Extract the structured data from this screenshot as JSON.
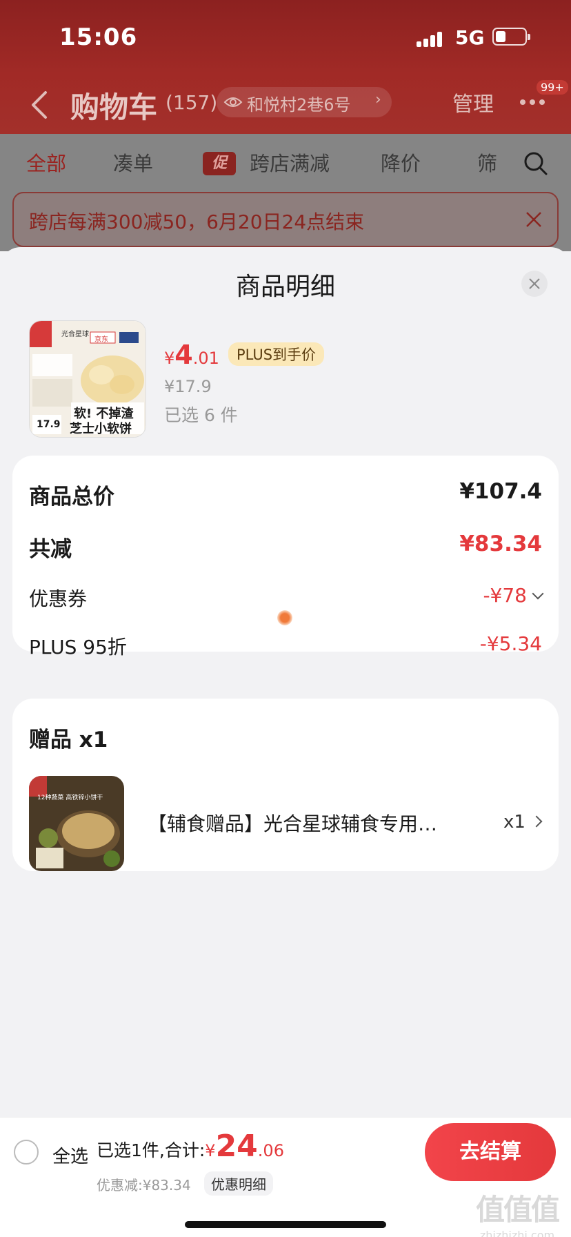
{
  "status_bar": {
    "time": "15:06",
    "network": "5G"
  },
  "nav": {
    "title": "购物车",
    "count": "(157)",
    "address": "和悦村2巷6号",
    "manage": "管理",
    "badge": "99+"
  },
  "tabs": [
    {
      "label": "全部"
    },
    {
      "label": "凑单"
    },
    {
      "label": "跨店满减",
      "tag": "促"
    },
    {
      "label": "降价"
    },
    {
      "label": "筛"
    }
  ],
  "notice": {
    "text": "跨店每满300减50，6月20日24点结束"
  },
  "sheet": {
    "title": "商品明细",
    "product": {
      "price_currency": "¥",
      "price_int": "4",
      "price_dec": ".01",
      "plus_tag": "PLUS到手价",
      "original_price": "¥17.9",
      "selected": "已选 6 件",
      "image_text": {
        "brand": "光合星球",
        "tag1": "软! 不掉渣",
        "tag2": "芝士小软饼",
        "price": "17.9",
        "jd": "京东"
      }
    },
    "summary": {
      "total_label": "商品总价",
      "total_value": "¥107.4",
      "reduce_label": "共减",
      "reduce_value": "¥83.34",
      "coupon_label": "优惠券",
      "coupon_value": "-¥78",
      "plus_label": "PLUS 95折",
      "plus_value": "-¥5.34"
    },
    "gift": {
      "title": "赠品 x1",
      "name": "【辅食赠品】光合星球辅食专用…",
      "qty": "x1",
      "image_text": "12种蔬菜 高铁锌小饼干"
    }
  },
  "bottom": {
    "select_all": "全选",
    "total_prefix": "已选1件,合计:",
    "total_currency": "¥",
    "total_int": "24",
    "total_dec": ".06",
    "discount": "优惠减:¥83.34",
    "detail": "优惠明细",
    "checkout": "去结算"
  },
  "watermark": {
    "logo": "值值值",
    "url": "zhizhizhi.com"
  },
  "colors": {
    "accent": "#e4393c",
    "header": "#a12a26",
    "plus_tag_bg": "#fbe8b8"
  }
}
